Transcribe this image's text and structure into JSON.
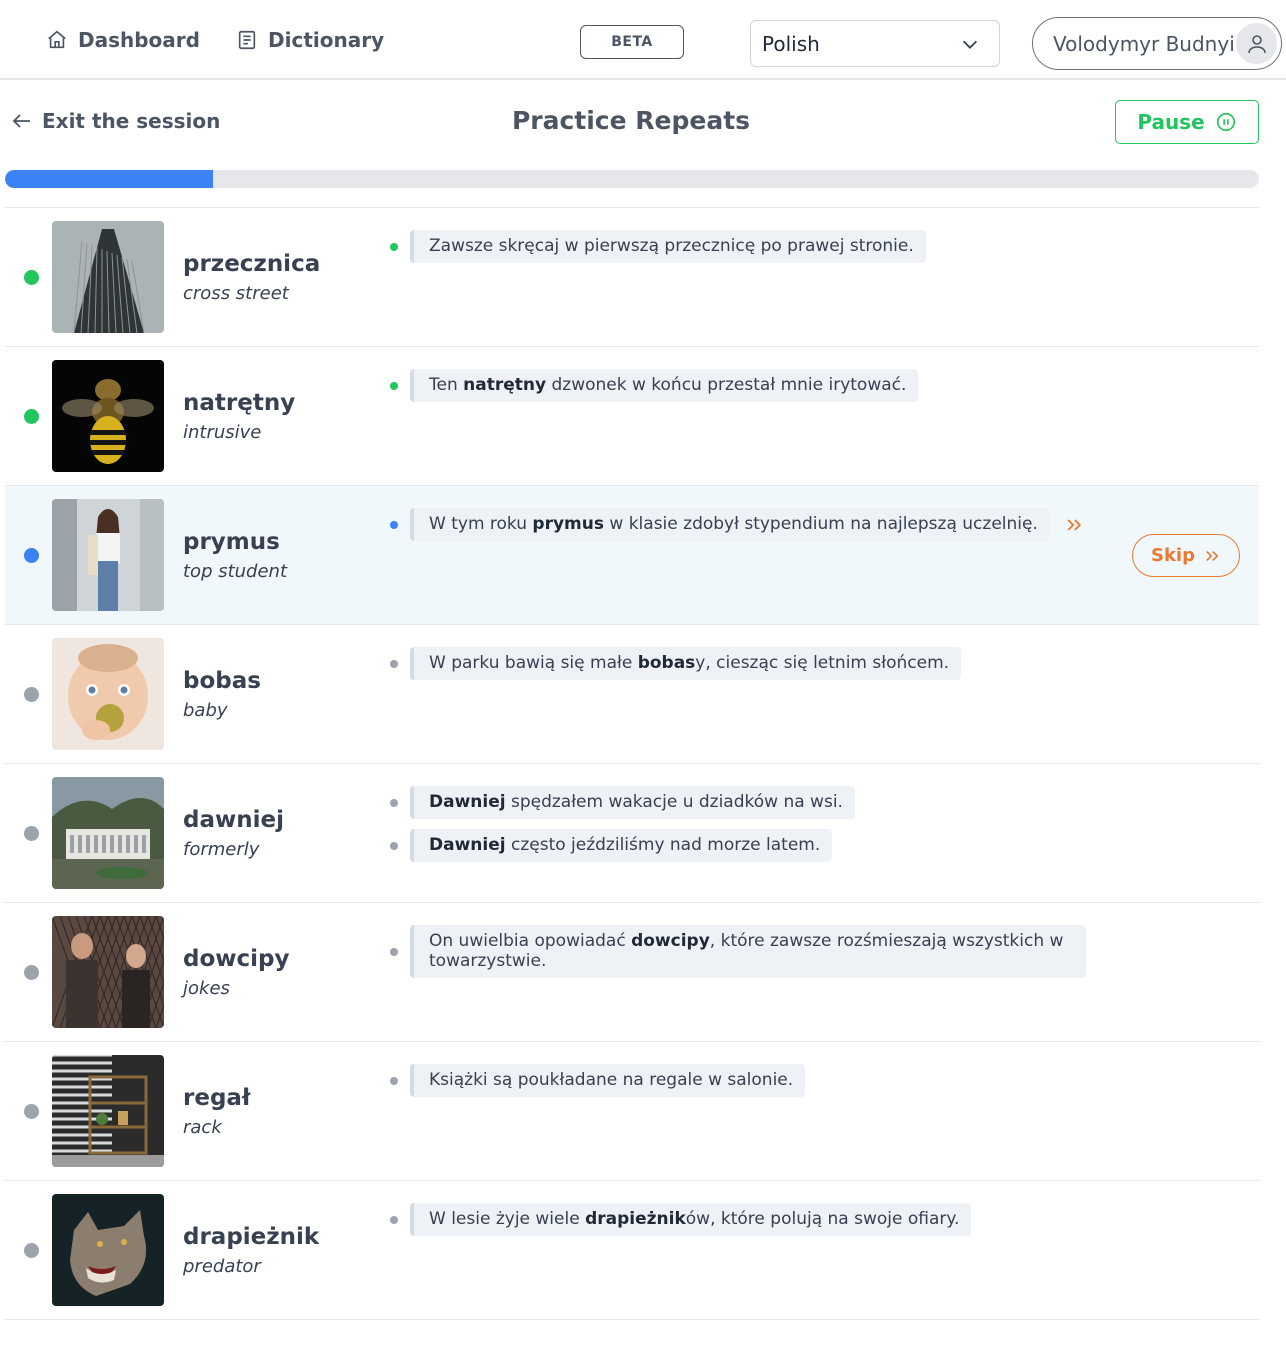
{
  "header": {
    "nav": [
      {
        "label": "Dashboard",
        "icon": "home-icon"
      },
      {
        "label": "Dictionary",
        "icon": "book-icon"
      }
    ],
    "beta_label": "BETA",
    "language": {
      "selected": "Polish"
    },
    "user": {
      "name": "Volodymyr Budnyi"
    }
  },
  "session": {
    "exit_label": "Exit the session",
    "title": "Practice Repeats",
    "pause_label": "Pause",
    "progress_fraction": 0.166
  },
  "colors": {
    "accent": "#3b82f6",
    "done": "#22c55e",
    "pending": "#9ca3af",
    "skip": "#ea7a30"
  },
  "words": [
    {
      "word": "przecznica",
      "translation": "cross street",
      "status": "done",
      "image": "skyscraper",
      "sentences": [
        {
          "before": "Zawsze skręcaj w pierwszą przecznicę po prawej stronie.",
          "bold": "",
          "after": ""
        }
      ]
    },
    {
      "word": "natrętny",
      "translation": "intrusive",
      "status": "done",
      "image": "wasp",
      "sentences": [
        {
          "before": "Ten ",
          "bold": "natrętny",
          "after": " dzwonek w końcu przestał mnie irytować."
        }
      ]
    },
    {
      "word": "prymus",
      "translation": "top student",
      "status": "active",
      "image": "woman",
      "skip_label": "Skip",
      "sentences": [
        {
          "before": "W tym roku ",
          "bold": "prymus",
          "after": " w klasie zdobył stypendium na najlepszą uczelnię."
        }
      ]
    },
    {
      "word": "bobas",
      "translation": "baby",
      "status": "pending",
      "image": "baby",
      "sentences": [
        {
          "before": "W parku bawią się małe ",
          "bold": "bobas",
          "after": "y, ciesząc się letnim słońcem."
        }
      ]
    },
    {
      "word": "dawniej",
      "translation": "formerly",
      "status": "pending",
      "image": "building",
      "sentences": [
        {
          "before": "",
          "bold": "Dawniej",
          "after": " spędzałem wakacje u dziadków na wsi."
        },
        {
          "before": "",
          "bold": "Dawniej",
          "after": " często jeździliśmy nad morze latem."
        }
      ]
    },
    {
      "word": "dowcipy",
      "translation": "jokes",
      "status": "pending",
      "image": "couple",
      "sentences": [
        {
          "before": "On uwielbia opowiadać ",
          "bold": "dowcipy",
          "after": ", które zawsze rozśmieszają wszystkich w towarzystwie."
        }
      ]
    },
    {
      "word": "regał",
      "translation": "rack",
      "status": "pending",
      "image": "shelf",
      "sentences": [
        {
          "before": "Książki są poukładane na regale w salonie.",
          "bold": "",
          "after": ""
        }
      ]
    },
    {
      "word": "drapieżnik",
      "translation": "predator",
      "status": "pending",
      "image": "wolf",
      "sentences": [
        {
          "before": "W lesie żyje wiele ",
          "bold": "drapieżnik",
          "after": "ów, które polują na swoje ofiary."
        }
      ]
    }
  ]
}
